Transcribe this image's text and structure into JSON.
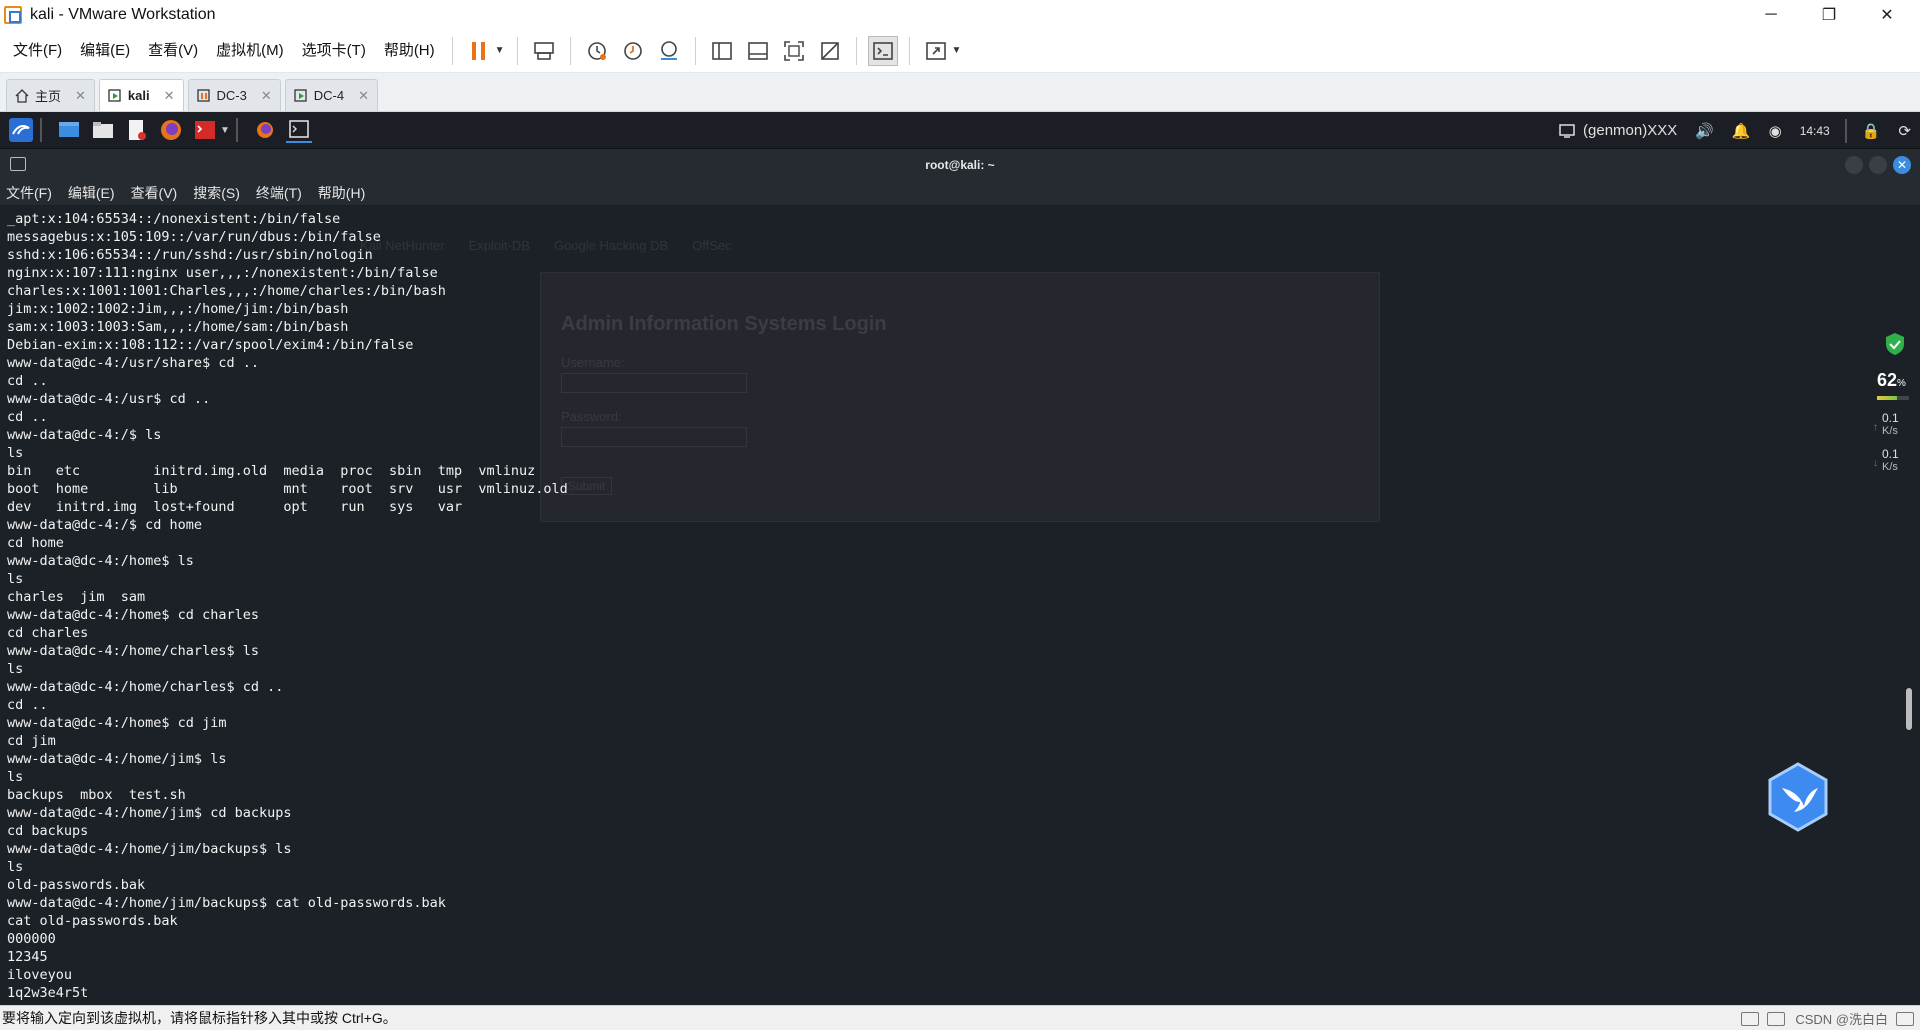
{
  "window": {
    "title": "kali - VMware Workstation",
    "minimize": "─",
    "restore": "❐",
    "close": "✕"
  },
  "menu": [
    "文件(F)",
    "编辑(E)",
    "查看(V)",
    "虚拟机(M)",
    "选项卡(T)",
    "帮助(H)"
  ],
  "toolbar": {
    "icons": [
      "pause-icon",
      "send-ctrl-alt-del-icon",
      "snapshot-icon",
      "revert-snapshot-icon",
      "snapshot-manager-icon",
      "sidebar-icon",
      "thumbnail-bar-icon",
      "fullscreen-icon",
      "unity-icon",
      "console-view-icon",
      "stretch-icon"
    ],
    "accent": "#e8731a"
  },
  "tabs": [
    {
      "label": "主页",
      "active": false
    },
    {
      "label": "kali",
      "active": true
    },
    {
      "label": "DC-3",
      "active": false
    },
    {
      "label": "DC-4",
      "active": false
    }
  ],
  "panel": {
    "genmon": "(genmon)XXX",
    "clock": "14:43",
    "accent": "#3c8de0"
  },
  "terminal": {
    "title": "root@kali: ~",
    "menu": [
      "文件(F)",
      "编辑(E)",
      "查看(V)",
      "搜索(S)",
      "终端(T)",
      "帮助(H)"
    ],
    "lines": [
      "_apt:x:104:65534::/nonexistent:/bin/false",
      "messagebus:x:105:109::/var/run/dbus:/bin/false",
      "sshd:x:106:65534::/run/sshd:/usr/sbin/nologin",
      "nginx:x:107:111:nginx user,,,:/nonexistent:/bin/false",
      "charles:x:1001:1001:Charles,,,:/home/charles:/bin/bash",
      "jim:x:1002:1002:Jim,,,:/home/jim:/bin/bash",
      "sam:x:1003:1003:Sam,,,:/home/sam:/bin/bash",
      "Debian-exim:x:108:112::/var/spool/exim4:/bin/false",
      "www-data@dc-4:/usr/share$ cd ..",
      "cd ..",
      "www-data@dc-4:/usr$ cd ..",
      "cd ..",
      "www-data@dc-4:/$ ls",
      "ls",
      "bin   etc         initrd.img.old  media  proc  sbin  tmp  vmlinuz",
      "boot  home        lib             mnt    root  srv   usr  vmlinuz.old",
      "dev   initrd.img  lost+found      opt    run   sys   var",
      "www-data@dc-4:/$ cd home",
      "cd home",
      "www-data@dc-4:/home$ ls",
      "ls",
      "charles  jim  sam",
      "www-data@dc-4:/home$ cd charles",
      "cd charles",
      "www-data@dc-4:/home/charles$ ls",
      "ls",
      "www-data@dc-4:/home/charles$ cd ..",
      "cd ..",
      "www-data@dc-4:/home$ cd jim",
      "cd jim",
      "www-data@dc-4:/home/jim$ ls",
      "ls",
      "backups  mbox  test.sh",
      "www-data@dc-4:/home/jim$ cd backups",
      "cd backups",
      "www-data@dc-4:/home/jim/backups$ ls",
      "ls",
      "old-passwords.bak",
      "www-data@dc-4:/home/jim/backups$ cat old-passwords.bak",
      "cat old-passwords.bak",
      "000000",
      "12345",
      "iloveyou",
      "1q2w3e4r5t"
    ]
  },
  "ghost_browser": {
    "bookmarks": [
      "Kali NetHunter",
      "Exploit-DB",
      "Google Hacking DB",
      "OffSec"
    ],
    "heading": "Admin Information Systems Login",
    "username_label": "Username:",
    "password_label": "Password:",
    "submit": "Submit"
  },
  "widget": {
    "percent": "62",
    "percent_unit": "%",
    "percent_value": 0.62,
    "up_speed": "0.1",
    "down_speed": "0.1",
    "speed_unit": "K/s"
  },
  "status": {
    "message": "要将输入定向到该虚拟机，请将鼠标指针移入其中或按 Ctrl+G。",
    "watermark": "CSDN @洗白白"
  }
}
